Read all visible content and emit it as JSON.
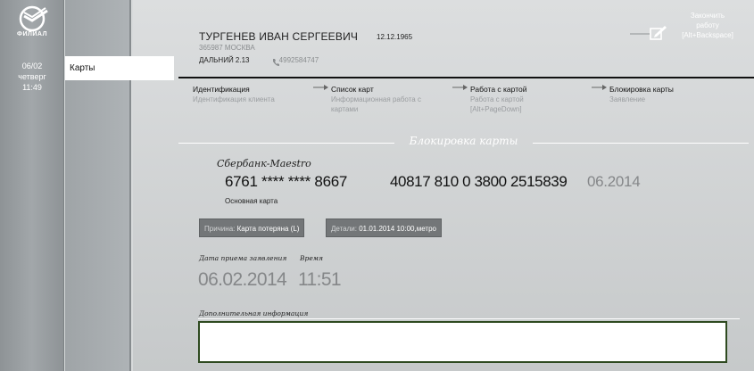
{
  "branch": {
    "logo_text": "ФИЛИАЛ",
    "logo_icon": "sberbank-logo-icon"
  },
  "datetime": {
    "date": "06/02",
    "weekday": "четверг",
    "time": "11:49"
  },
  "nav": {
    "active_item": "Карты"
  },
  "client": {
    "name": "ТУРГЕНЕВ ИВАН СЕРГЕЕВИЧ",
    "dob": "12.12.1965",
    "address": "365987 МОСКВА",
    "street": "ДАЛЬНИЙ 2.13",
    "phone": "4992584747"
  },
  "finish": {
    "line1": "Закончить",
    "line2": "работу",
    "line3": "[Alt+Backspace]",
    "icon": "pencil-edit-icon"
  },
  "steps": [
    {
      "title": "Идентификация",
      "sub1": "Идентификация клиента",
      "sub2": ""
    },
    {
      "title": "Список карт",
      "sub1": "Информационная работа с",
      "sub2": "картами"
    },
    {
      "title": "Работа с картой",
      "sub1": "Работа с картой",
      "sub2": "[Alt+PageDown]"
    },
    {
      "title": "Блокировка карты",
      "sub1": "Заявление",
      "sub2": ""
    }
  ],
  "section": {
    "title": "Блокировка карты"
  },
  "card": {
    "type": "Сбербанк-Maestro",
    "number": "6761 **** **** 8667",
    "account": "40817 810 0 3800 2515839",
    "expiry": "06.2014",
    "kind": "Основная карта"
  },
  "reason": {
    "label": "Причина:",
    "value": "Карта потеряна (L)"
  },
  "details": {
    "label": "Детали:",
    "value": "01.01.2014 10:00,метро"
  },
  "application": {
    "date_label": "Дата приема заявления",
    "date_value": "06.02.2014",
    "time_label": "Время",
    "time_value": "11:51"
  },
  "extra_info": {
    "label": "Дополнительная информация",
    "value": ""
  },
  "colors": {
    "accent_green": "#2e4a20",
    "sidebar_gray": "#9ea3a6",
    "muted_text": "#858789"
  }
}
